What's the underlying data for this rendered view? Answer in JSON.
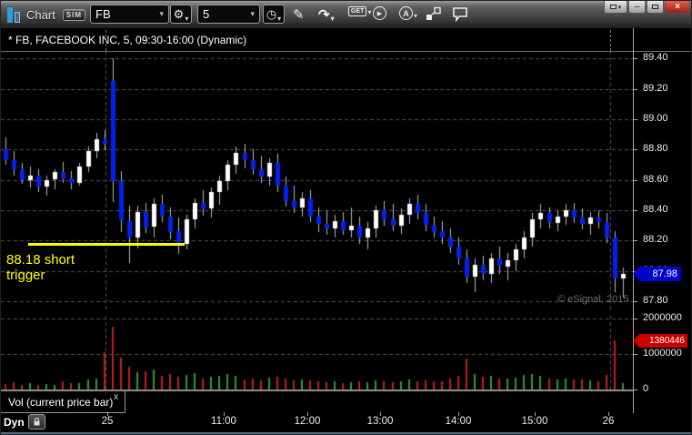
{
  "window": {
    "app_title": "Chart",
    "sim_badge": "SIM",
    "controls": {
      "minimize": "–",
      "close": "×"
    }
  },
  "toolbar": {
    "symbol_value": "FB",
    "interval_value": "5",
    "get_label": "GET",
    "auto_label": "A",
    "icons": {
      "gear": "⚙",
      "clock": "◷",
      "pencil": "✎",
      "redo": "↷",
      "play": "▶",
      "caret": "▾"
    }
  },
  "pane_header": {
    "title": "* FB, FACEBOOK INC, 5, 09:30-16:00 (Dynamic)"
  },
  "annotation": {
    "text_line1": "88.18 short",
    "text_line2": "trigger",
    "color": "#ffff00"
  },
  "watermark": {
    "text": "© eSignal, 2015"
  },
  "price_axis": {
    "ticks": [
      "89.40",
      "89.20",
      "89.00",
      "88.80",
      "88.60",
      "88.40",
      "88.20",
      "88.00",
      "87.80"
    ],
    "last_price_badge": "87.98",
    "badge_color": "#0000cc"
  },
  "volume_axis": {
    "ticks": [
      {
        "label": "2000000",
        "value": 2000000
      },
      {
        "label": "1000000",
        "value": 1000000
      },
      {
        "label": "0",
        "value": 0
      }
    ],
    "current_volume_badge": "1380446",
    "badge_color": "#cc0000"
  },
  "time_axis": {
    "labels": [
      {
        "text": "25",
        "frac": 0.168
      },
      {
        "text": "11:00",
        "frac": 0.3525
      },
      {
        "text": "12:00",
        "frac": 0.485
      },
      {
        "text": "13:00",
        "frac": 0.6
      },
      {
        "text": "14:00",
        "frac": 0.7237
      },
      {
        "text": "15:00",
        "frac": 0.8446
      },
      {
        "text": "26",
        "frac": 0.961
      }
    ]
  },
  "study_bar": {
    "label": "Vol (current price bar)",
    "close_label": "x"
  },
  "status_bar": {
    "mode_label": "Dyn"
  },
  "chart_data": {
    "type": "candlestick",
    "title": "FB, FACEBOOK INC, 5, 09:30-16:00 (Dynamic)",
    "symbol": "FB",
    "interval_minutes": 5,
    "session": "09:30-16:00",
    "mode": "Dynamic",
    "ylim": [
      87.74,
      89.45
    ],
    "volume_ylim": [
      0,
      2050000
    ],
    "last_price": 87.98,
    "current_bar_volume": 1380446,
    "session_break_fracs": [
      0.1655,
      0.964
    ],
    "trigger_line": {
      "price": 88.18,
      "x_start_frac": 0.043,
      "x_end_frac": 0.29
    },
    "colors": {
      "up": "#ffffff",
      "down": "#0022ee",
      "wick": "#bbbbbb",
      "vol_up": "#2f9e2f",
      "vol_down": "#c42020",
      "grid": "#555555"
    },
    "candles": [
      [
        88.8,
        88.88,
        88.7,
        88.73
      ],
      [
        88.73,
        88.79,
        88.63,
        88.67
      ],
      [
        88.67,
        88.71,
        88.57,
        88.6
      ],
      [
        88.6,
        88.69,
        88.55,
        88.63
      ],
      [
        88.63,
        88.67,
        88.52,
        88.56
      ],
      [
        88.56,
        88.63,
        88.5,
        88.6
      ],
      [
        88.6,
        88.67,
        88.54,
        88.65
      ],
      [
        88.65,
        88.72,
        88.58,
        88.61
      ],
      [
        88.61,
        88.66,
        88.54,
        88.58
      ],
      [
        88.58,
        88.71,
        88.56,
        88.69
      ],
      [
        88.69,
        88.82,
        88.65,
        88.79
      ],
      [
        88.79,
        88.91,
        88.74,
        88.87
      ],
      [
        88.87,
        88.93,
        88.8,
        88.84
      ],
      [
        89.25,
        89.4,
        88.45,
        88.59
      ],
      [
        88.59,
        88.66,
        88.26,
        88.33
      ],
      [
        88.33,
        88.43,
        88.05,
        88.22
      ],
      [
        88.22,
        88.43,
        88.15,
        88.39
      ],
      [
        88.39,
        88.45,
        88.25,
        88.29
      ],
      [
        88.29,
        88.48,
        88.22,
        88.44
      ],
      [
        88.44,
        88.5,
        88.32,
        88.36
      ],
      [
        88.36,
        88.42,
        88.21,
        88.26
      ],
      [
        88.26,
        88.35,
        88.11,
        88.18
      ],
      [
        88.18,
        88.37,
        88.14,
        88.34
      ],
      [
        88.34,
        88.48,
        88.28,
        88.45
      ],
      [
        88.45,
        88.53,
        88.36,
        88.41
      ],
      [
        88.41,
        88.55,
        88.35,
        88.52
      ],
      [
        88.52,
        88.63,
        88.44,
        88.59
      ],
      [
        88.59,
        88.73,
        88.53,
        88.7
      ],
      [
        88.7,
        88.82,
        88.64,
        88.78
      ],
      [
        88.78,
        88.84,
        88.68,
        88.73
      ],
      [
        88.73,
        88.8,
        88.63,
        88.67
      ],
      [
        88.67,
        88.76,
        88.58,
        88.62
      ],
      [
        88.62,
        88.74,
        88.56,
        88.71
      ],
      [
        88.71,
        88.77,
        88.52,
        88.56
      ],
      [
        88.56,
        88.62,
        88.42,
        88.46
      ],
      [
        88.46,
        88.56,
        88.38,
        88.42
      ],
      [
        88.42,
        88.52,
        88.36,
        88.48
      ],
      [
        88.48,
        88.53,
        88.32,
        88.36
      ],
      [
        88.36,
        88.42,
        88.26,
        88.31
      ],
      [
        88.31,
        88.4,
        88.24,
        88.28
      ],
      [
        88.28,
        88.37,
        88.22,
        88.33
      ],
      [
        88.33,
        88.39,
        88.24,
        88.27
      ],
      [
        88.27,
        88.42,
        88.22,
        88.3
      ],
      [
        88.3,
        88.36,
        88.18,
        88.22
      ],
      [
        88.22,
        88.32,
        88.14,
        88.28
      ],
      [
        88.28,
        88.43,
        88.22,
        88.4
      ],
      [
        88.4,
        88.46,
        88.3,
        88.34
      ],
      [
        88.34,
        88.44,
        88.26,
        88.3
      ],
      [
        88.3,
        88.41,
        88.24,
        88.37
      ],
      [
        88.37,
        88.48,
        88.31,
        88.44
      ],
      [
        88.44,
        88.5,
        88.34,
        88.38
      ],
      [
        88.38,
        88.44,
        88.26,
        88.3
      ],
      [
        88.3,
        88.36,
        88.22,
        88.26
      ],
      [
        88.26,
        88.33,
        88.18,
        88.22
      ],
      [
        88.22,
        88.28,
        88.12,
        88.16
      ],
      [
        88.16,
        88.22,
        88.04,
        88.08
      ],
      [
        88.08,
        88.14,
        87.92,
        87.96
      ],
      [
        87.96,
        88.08,
        87.86,
        88.04
      ],
      [
        88.04,
        88.1,
        87.94,
        87.98
      ],
      [
        87.98,
        88.12,
        87.92,
        88.08
      ],
      [
        88.08,
        88.16,
        87.98,
        88.03
      ],
      [
        88.03,
        88.12,
        87.94,
        88.07
      ],
      [
        88.07,
        88.18,
        88.0,
        88.14
      ],
      [
        88.14,
        88.26,
        88.08,
        88.22
      ],
      [
        88.22,
        88.38,
        88.16,
        88.34
      ],
      [
        88.34,
        88.44,
        88.28,
        88.38
      ],
      [
        88.38,
        88.42,
        88.28,
        88.32
      ],
      [
        88.32,
        88.4,
        88.26,
        88.36
      ],
      [
        88.36,
        88.44,
        88.3,
        88.4
      ],
      [
        88.4,
        88.45,
        88.32,
        88.35
      ],
      [
        88.35,
        88.41,
        88.27,
        88.31
      ],
      [
        88.31,
        88.39,
        88.24,
        88.35
      ],
      [
        88.35,
        88.4,
        88.28,
        88.32
      ],
      [
        88.32,
        88.38,
        88.18,
        88.22
      ],
      [
        88.22,
        88.26,
        87.86,
        87.95
      ],
      [
        87.95,
        88.02,
        87.82,
        87.98
      ]
    ],
    "volumes": [
      150000,
      210000,
      130000,
      180000,
      140000,
      160000,
      120000,
      230000,
      170000,
      190000,
      270000,
      320000,
      1050000,
      1780000,
      900000,
      650000,
      480000,
      520000,
      560000,
      380000,
      430000,
      360000,
      410000,
      460000,
      300000,
      350000,
      380000,
      430000,
      390000,
      280000,
      310000,
      260000,
      330000,
      370000,
      300000,
      250000,
      280000,
      260000,
      240000,
      210000,
      230000,
      190000,
      210000,
      240000,
      200000,
      260000,
      220000,
      200000,
      230000,
      280000,
      240000,
      260000,
      220000,
      240000,
      300000,
      390000,
      860000,
      430000,
      350000,
      380000,
      320000,
      300000,
      340000,
      400000,
      440000,
      380000,
      300000,
      280000,
      310000,
      290000,
      270000,
      250000,
      230000,
      420000,
      1380446,
      180000
    ]
  }
}
